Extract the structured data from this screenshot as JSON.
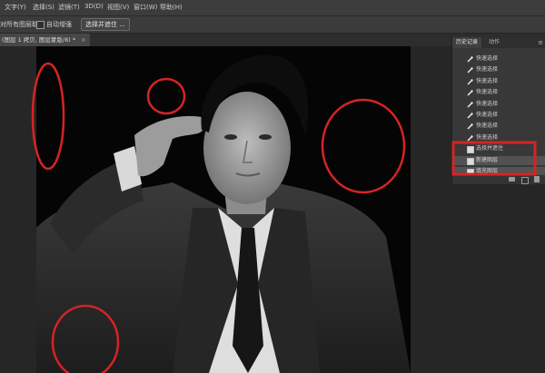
{
  "menu": [
    "文字(Y)",
    "选择(S)",
    "滤镜(T)",
    "3D(D)",
    "视图(V)",
    "窗口(W)",
    "帮助(H)"
  ],
  "options": {
    "sample_all_layers": "对所有图层取样",
    "auto_enhance": "自动增强",
    "select_and_mask_button": "选择并遮住 ..."
  },
  "document_tab": "(图层 1 拷贝, 图层蒙版/8) *",
  "document_tab_close": "×",
  "history_panel": {
    "tabs": [
      "历史记录",
      "动作"
    ],
    "menu_glyph": "≡",
    "items": [
      {
        "label": "快速选择",
        "icon": "quick-select-brush",
        "selected": false
      },
      {
        "label": "快速选择",
        "icon": "quick-select-brush",
        "selected": false
      },
      {
        "label": "快速选择",
        "icon": "quick-select-brush",
        "selected": false
      },
      {
        "label": "快速选择",
        "icon": "quick-select-brush",
        "selected": false
      },
      {
        "label": "快速选择",
        "icon": "quick-select-brush",
        "selected": false
      },
      {
        "label": "快速选择",
        "icon": "quick-select-brush",
        "selected": false
      },
      {
        "label": "快速选择",
        "icon": "quick-select-brush",
        "selected": false
      },
      {
        "label": "快速选择",
        "icon": "quick-select-brush",
        "selected": false
      },
      {
        "label": "选择并遮住",
        "icon": "document",
        "selected": false
      },
      {
        "label": "新建图层",
        "icon": "document",
        "selected": true
      },
      {
        "label": "填充图层",
        "icon": "document",
        "selected": true
      }
    ]
  },
  "annotation_color": "#d42424"
}
